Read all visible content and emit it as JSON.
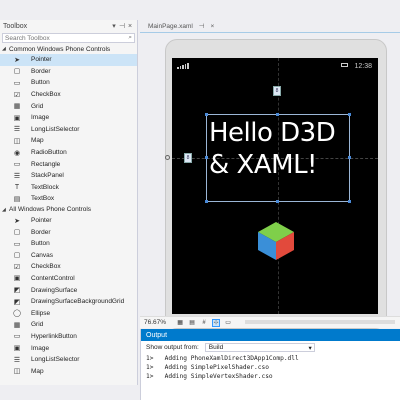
{
  "toolbox": {
    "title": "Toolbox",
    "pin_glyph": "▾ ⊣ ×",
    "search_placeholder": "Search Toolbox",
    "groups": [
      {
        "label": "Common Windows Phone Controls",
        "items": [
          {
            "label": "Pointer",
            "icon": "pointer-icon",
            "selected": true
          },
          {
            "label": "Border",
            "icon": "border-icon"
          },
          {
            "label": "Button",
            "icon": "button-icon"
          },
          {
            "label": "CheckBox",
            "icon": "checkbox-icon"
          },
          {
            "label": "Grid",
            "icon": "grid-icon"
          },
          {
            "label": "Image",
            "icon": "image-icon"
          },
          {
            "label": "LongListSelector",
            "icon": "list-icon"
          },
          {
            "label": "Map",
            "icon": "map-icon"
          },
          {
            "label": "RadioButton",
            "icon": "radio-icon"
          },
          {
            "label": "Rectangle",
            "icon": "rectangle-icon"
          },
          {
            "label": "StackPanel",
            "icon": "stackpanel-icon"
          },
          {
            "label": "TextBlock",
            "icon": "textblock-icon"
          },
          {
            "label": "TextBox",
            "icon": "textbox-icon"
          }
        ]
      },
      {
        "label": "All Windows Phone Controls",
        "items": [
          {
            "label": "Pointer",
            "icon": "pointer-icon"
          },
          {
            "label": "Border",
            "icon": "border-icon"
          },
          {
            "label": "Button",
            "icon": "button-icon"
          },
          {
            "label": "Canvas",
            "icon": "canvas-icon"
          },
          {
            "label": "CheckBox",
            "icon": "checkbox-icon"
          },
          {
            "label": "ContentControl",
            "icon": "contentcontrol-icon"
          },
          {
            "label": "DrawingSurface",
            "icon": "drawingsurface-icon"
          },
          {
            "label": "DrawingSurfaceBackgroundGrid",
            "icon": "drawingsurface-icon"
          },
          {
            "label": "Ellipse",
            "icon": "ellipse-icon"
          },
          {
            "label": "Grid",
            "icon": "grid-icon"
          },
          {
            "label": "HyperlinkButton",
            "icon": "hyperlink-icon"
          },
          {
            "label": "Image",
            "icon": "image-icon"
          },
          {
            "label": "LongListSelector",
            "icon": "list-icon"
          },
          {
            "label": "Map",
            "icon": "map-icon"
          }
        ]
      }
    ]
  },
  "document_tab": {
    "label": "MainPage.xaml",
    "modified_marker": "⊣",
    "close": "×"
  },
  "phone": {
    "clock": "12:38",
    "hello_text": "Hello D3D & XAML!",
    "hello_line1": "Hello D3D",
    "hello_line2": "& XAML!",
    "margin_badge_top": "8",
    "margin_badge_left": "8"
  },
  "designer_toolbar": {
    "zoom": "76.67%",
    "buttons": [
      "grid-view-icon",
      "snap-grid-icon",
      "grid-icon",
      "snap-lines-icon",
      "annotation-icon"
    ]
  },
  "output": {
    "title": "Output",
    "show_label": "Show output from:",
    "source": "Build",
    "lines": [
      "1>   Adding PhoneXamlDirect3DApp1Comp.dll",
      "1>   Adding SimplePixelShader.cso",
      "1>   Adding SimpleVertexShader.cso"
    ]
  },
  "colors": {
    "accent": "#007acc",
    "selection": "#cce4f7",
    "screen": "#000000",
    "cube_top": "#7fcf4a",
    "cube_left": "#3a8fd8",
    "cube_right": "#e24a3c"
  }
}
